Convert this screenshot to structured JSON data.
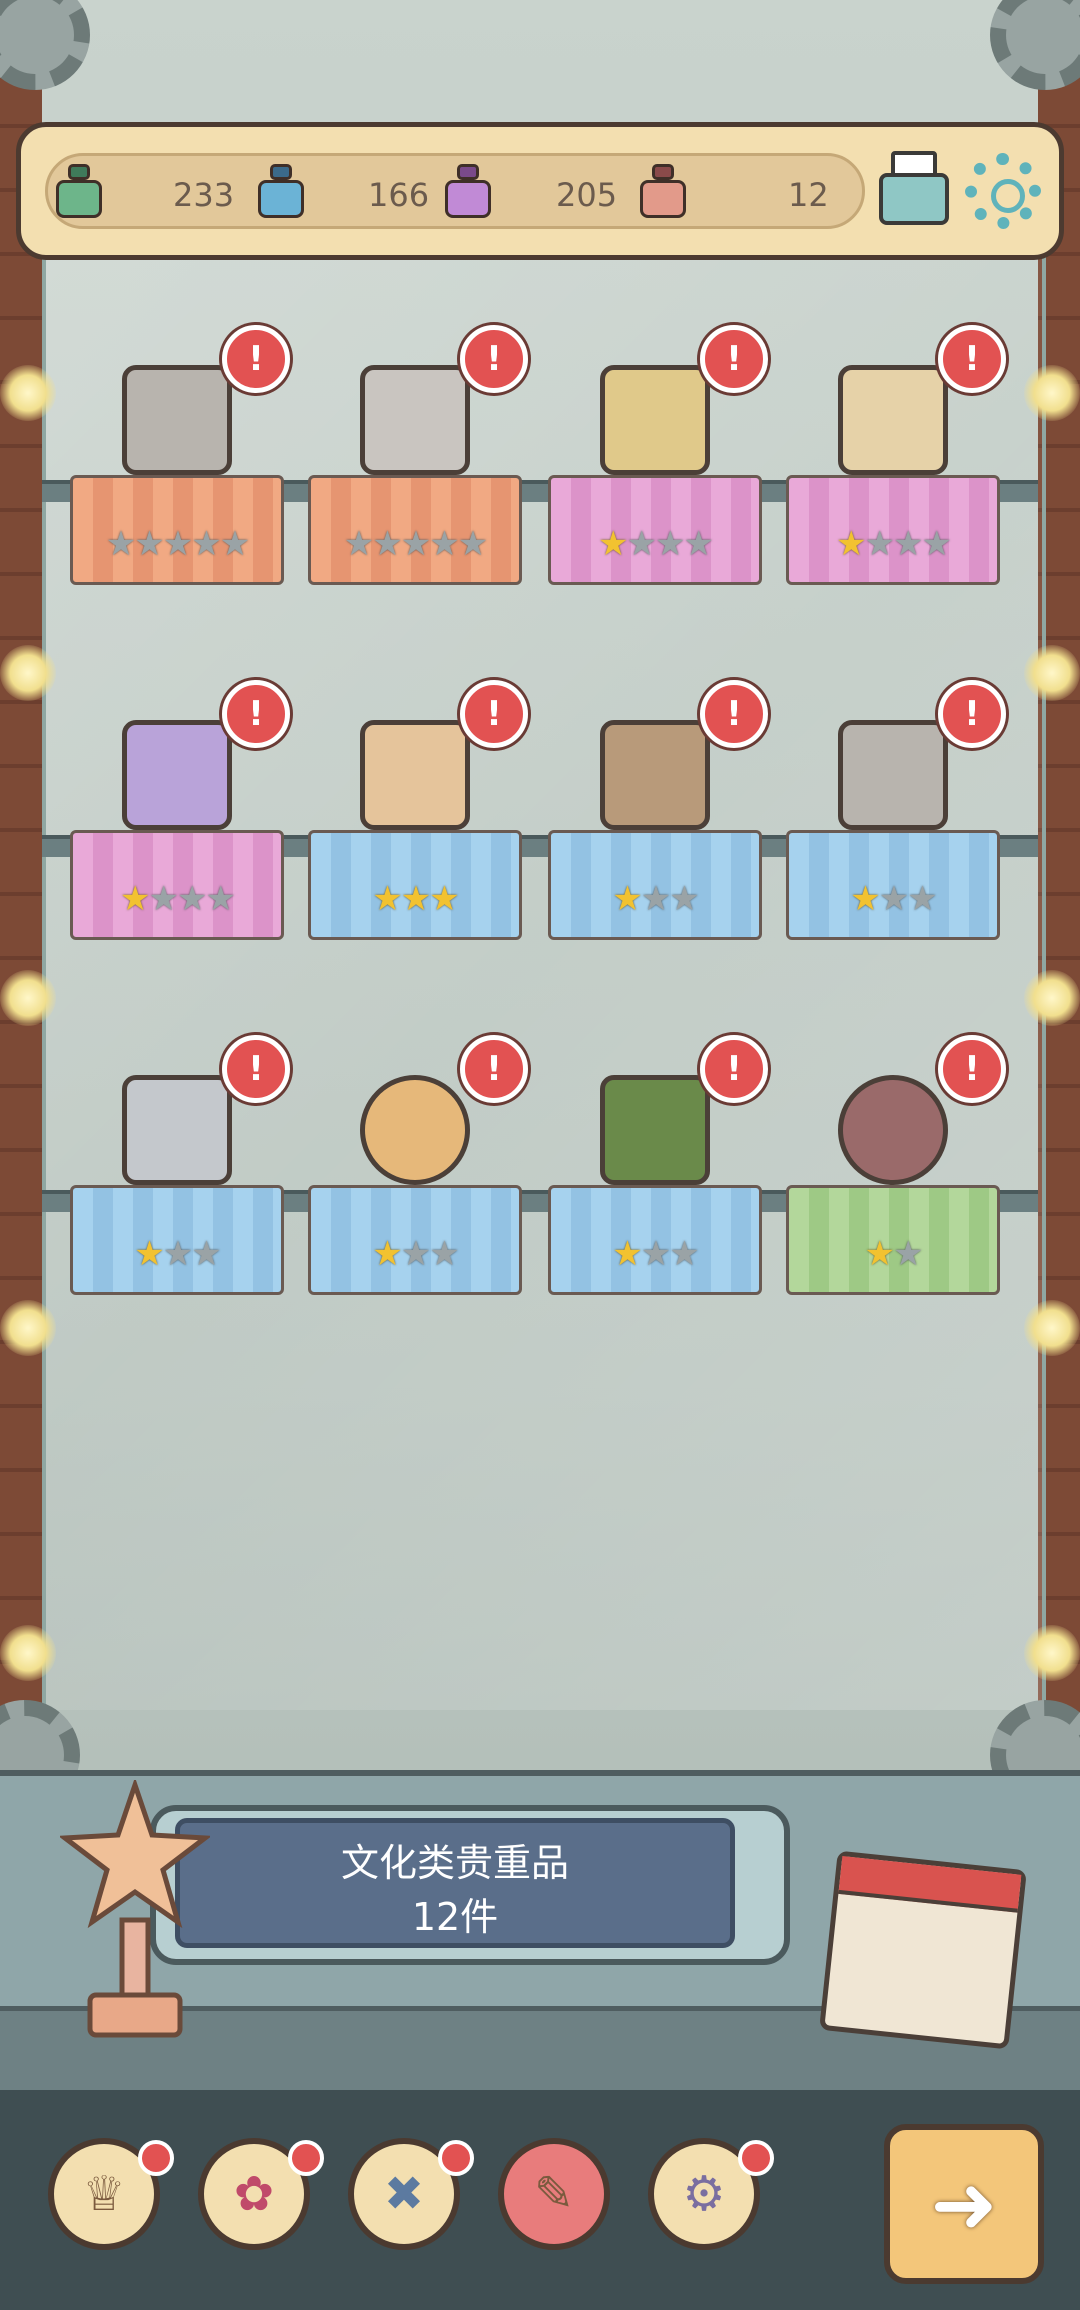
{
  "resources": [
    {
      "icon": "ink-bottle-green-icon",
      "value": "233"
    },
    {
      "icon": "ink-bottle-blue-icon",
      "value": "166"
    },
    {
      "icon": "ink-bottle-purple-icon",
      "value": "205"
    },
    {
      "icon": "ink-bottle-red-icon",
      "value": "12"
    }
  ],
  "top_actions": {
    "mail_icon": "mail-icon",
    "settings_icon": "gear-icon"
  },
  "colors": {
    "alert": "#e25252",
    "star_on": "#f2c230",
    "star_off": "#9aa3a6",
    "panel": "#5a6e8a"
  },
  "shelves": [
    {
      "items": [
        {
          "name": "statue",
          "color": "orange",
          "stars_on": 0,
          "stars_total": 5,
          "alert": true
        },
        {
          "name": "stone-relief",
          "color": "orange",
          "stars_on": 0,
          "stars_total": 5,
          "alert": true
        },
        {
          "name": "portrait-book",
          "color": "pink",
          "stars_on": 1,
          "stars_total": 4,
          "alert": true
        },
        {
          "name": "open-book",
          "color": "pink",
          "stars_on": 1,
          "stars_total": 4,
          "alert": true
        }
      ]
    },
    {
      "items": [
        {
          "name": "purple-book",
          "color": "pink",
          "stars_on": 1,
          "stars_total": 4,
          "alert": true
        },
        {
          "name": "scroll",
          "color": "blue",
          "stars_on": 3,
          "stars_total": 3,
          "alert": true
        },
        {
          "name": "arrow",
          "color": "blue",
          "stars_on": 1,
          "stars_total": 3,
          "alert": true
        },
        {
          "name": "fish-skeleton",
          "color": "blue",
          "stars_on": 1,
          "stars_total": 3,
          "alert": true
        }
      ]
    },
    {
      "items": [
        {
          "name": "mask",
          "color": "blue",
          "stars_on": 1,
          "stars_total": 3,
          "alert": true
        },
        {
          "name": "lamp-orb",
          "color": "blue",
          "stars_on": 1,
          "stars_total": 3,
          "alert": true
        },
        {
          "name": "potted-plant",
          "color": "blue",
          "stars_on": 1,
          "stars_total": 3,
          "alert": true
        },
        {
          "name": "bread",
          "color": "green",
          "stars_on": 1,
          "stars_total": 2,
          "alert": true
        }
      ]
    }
  ],
  "panel": {
    "title": "文化类贵重品",
    "count": "12件"
  },
  "bottom_nav": [
    {
      "icon": "trophy-icon",
      "badge": true
    },
    {
      "icon": "rose-icon",
      "badge": true
    },
    {
      "icon": "bone-icon",
      "badge": true
    },
    {
      "icon": "quill-scroll-icon",
      "badge": false,
      "active": true
    },
    {
      "icon": "gear-icon",
      "badge": true
    }
  ],
  "next_button_icon": "arrow-right-icon"
}
